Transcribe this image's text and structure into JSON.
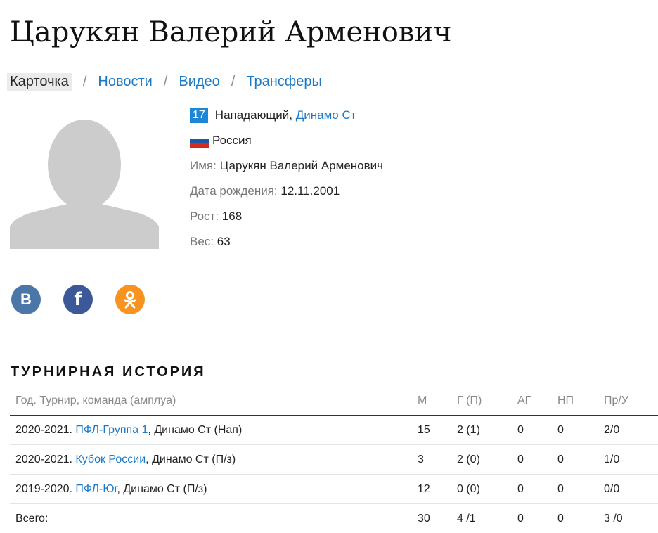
{
  "player": {
    "name": "Царукян Валерий Арменович",
    "number": "17",
    "position": "Нападающий",
    "club": "Динамо Ст",
    "country": "Россия",
    "full_name_label": "Имя:",
    "full_name": "Царукян Валерий Арменович",
    "birth_label": "Дата рождения:",
    "birth_date": "12.11.2001",
    "height_label": "Рост:",
    "height": "168",
    "weight_label": "Вес:",
    "weight": "63"
  },
  "tabs": [
    {
      "label": "Карточка",
      "active": true
    },
    {
      "label": "Новости",
      "active": false
    },
    {
      "label": "Видео",
      "active": false
    },
    {
      "label": "Трансферы",
      "active": false
    }
  ],
  "tab_separator": "/",
  "social": [
    {
      "name": "vk",
      "label": "В",
      "color": "#4a76a8"
    },
    {
      "name": "facebook",
      "label": "f",
      "color": "#3b5998"
    },
    {
      "name": "odnoklassniki",
      "label": "ok",
      "color": "#f7931e"
    }
  ],
  "history": {
    "title": "ТУРНИРНАЯ ИСТОРИЯ",
    "columns": [
      "Год. Турнир, команда (амплуа)",
      "М",
      "Г (П)",
      "АГ",
      "НП",
      "Пр/У"
    ],
    "rows": [
      {
        "season": "2020-2021.",
        "tournament": "ПФЛ-Группа 1",
        "team": ", Динамо Ст (Нап)",
        "m": "15",
        "g": "2 (1)",
        "ag": "0",
        "np": "0",
        "pr": "2/0"
      },
      {
        "season": "2020-2021.",
        "tournament": "Кубок России",
        "team": ", Динамо Ст (П/з)",
        "m": "3",
        "g": "2 (0)",
        "ag": "0",
        "np": "0",
        "pr": "1/0"
      },
      {
        "season": "2019-2020.",
        "tournament": "ПФЛ-Юг",
        "team": ", Динамо Ст (П/з)",
        "m": "12",
        "g": "0 (0)",
        "ag": "0",
        "np": "0",
        "pr": "0/0"
      }
    ],
    "total": {
      "label": "Всего:",
      "m": "30",
      "g": "4 /1",
      "ag": "0",
      "np": "0",
      "pr": "3 /0"
    }
  },
  "colors": {
    "link": "#1b79c7",
    "badge": "#1b87d6",
    "avatar": "#cccccc"
  }
}
